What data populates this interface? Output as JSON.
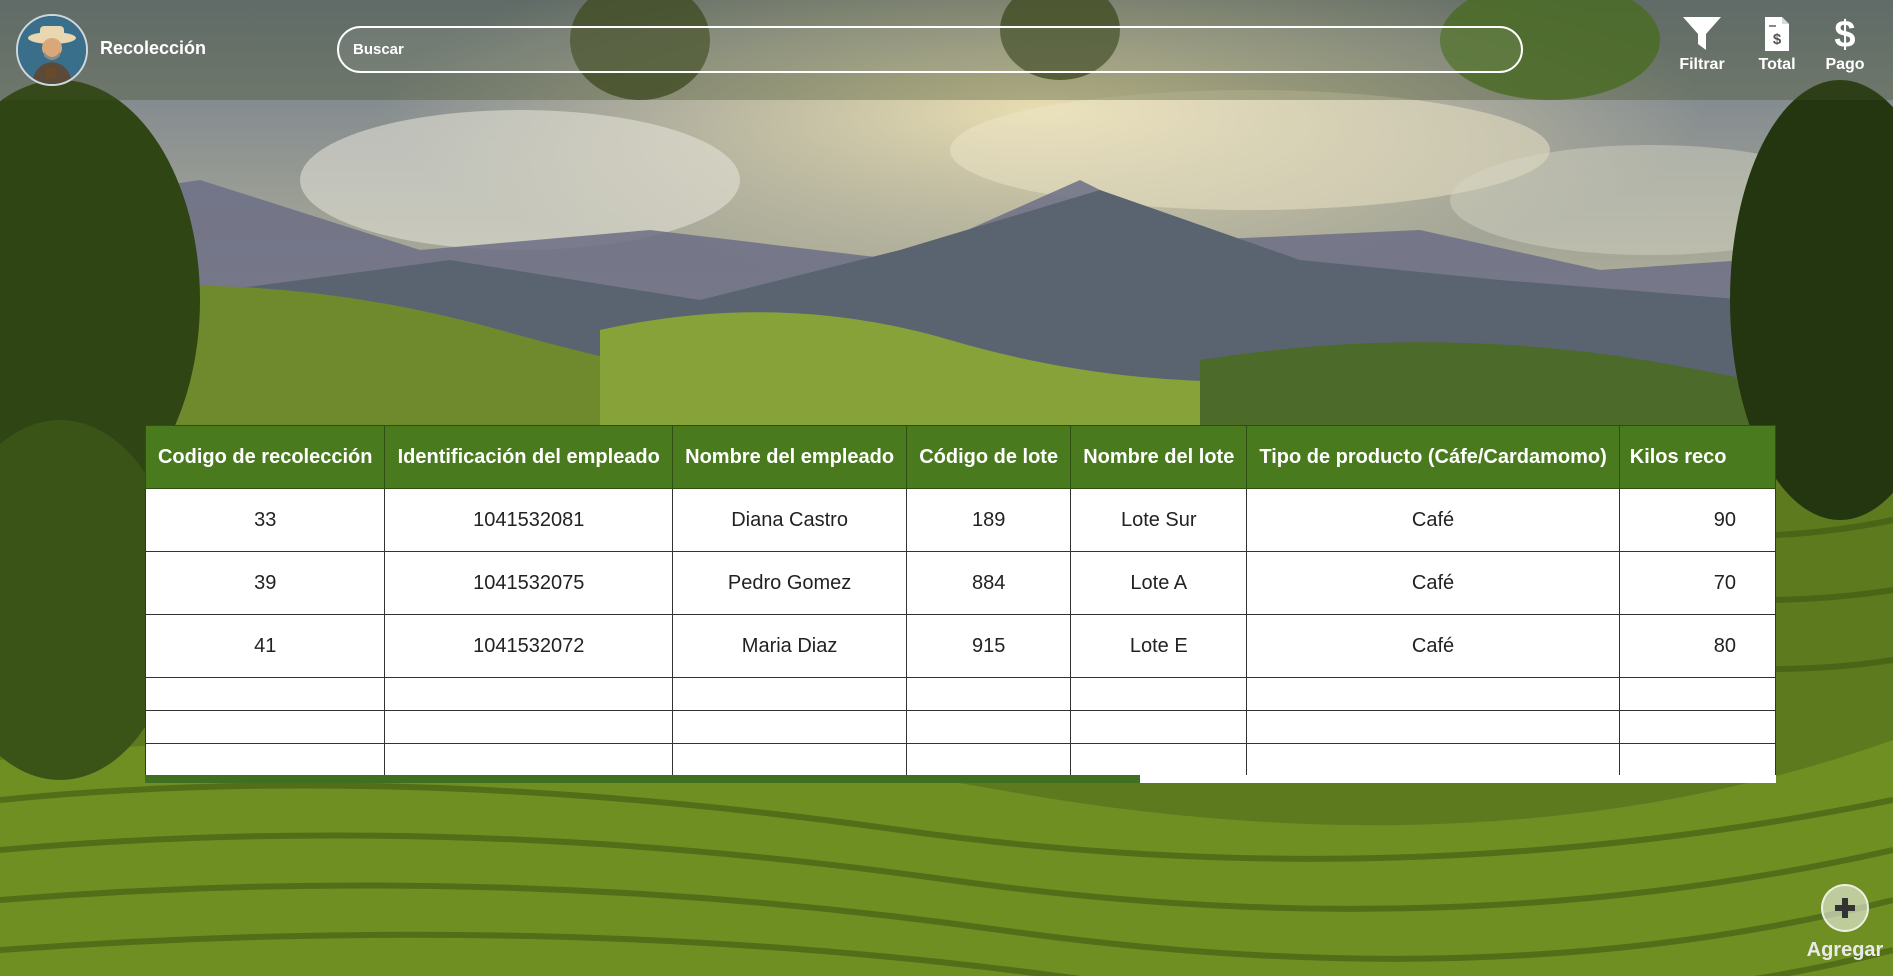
{
  "header": {
    "app_title": "Recolección",
    "search": {
      "placeholder": "Buscar",
      "value": ""
    },
    "actions": [
      {
        "label": "Filtrar",
        "icon": "filter-icon"
      },
      {
        "label": "Total",
        "icon": "invoice-icon"
      },
      {
        "label": "Pago",
        "icon": "dollar-icon"
      }
    ]
  },
  "table": {
    "columns": [
      "Codigo de recolección",
      "Identificación del empleado",
      "Nombre del empleado",
      "Código de lote",
      "Nombre del lote",
      "Tipo de producto (Cáfe/Cardamomo)",
      "Kilos reco"
    ],
    "rows": [
      [
        "33",
        "1041532081",
        "Diana Castro",
        "189",
        "Lote Sur",
        "Café",
        "90"
      ],
      [
        "39",
        "1041532075",
        "Pedro Gomez",
        "884",
        "Lote A",
        "Café",
        "70"
      ],
      [
        "41",
        "1041532072",
        "Maria Diaz",
        "915",
        "Lote E",
        "Café",
        "80"
      ]
    ],
    "empty_rows": 3,
    "scroll_fraction": 0.61
  },
  "add_button": {
    "label": "Agregar",
    "icon": "plus-icon"
  },
  "colors": {
    "header_green": "#4a7a1e",
    "scroll_thumb": "#3f7020"
  }
}
